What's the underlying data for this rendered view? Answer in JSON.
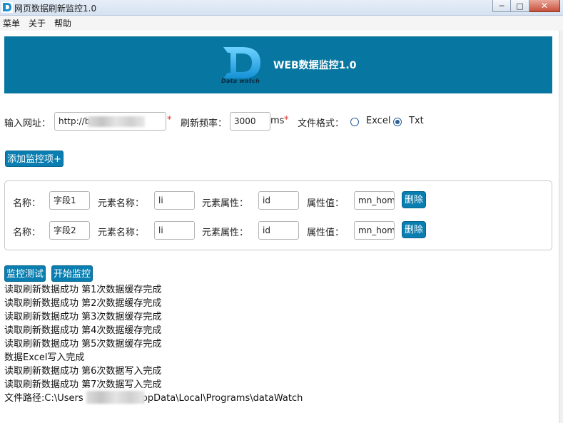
{
  "window": {
    "title": "网页数据刷新监控1.0",
    "min_icon": "minimize-icon",
    "max_icon": "maximize-icon",
    "close_icon": "close-icon",
    "min_glyph": "─",
    "max_glyph": "□",
    "close_glyph": "✕"
  },
  "menu": [
    "菜单",
    "关于",
    "帮助"
  ],
  "banner": {
    "logo_caption": "Data watch",
    "title": "WEB数据监控1.0",
    "bg_color": "#0776a0"
  },
  "form": {
    "url_label": "输入网址：",
    "url_value": "http://b",
    "required_mark": "*",
    "freq_label": "刷新频率：",
    "freq_value": "3000",
    "freq_unit": "ms",
    "format_label": "文件格式：",
    "format_options": [
      "Excel",
      "Txt"
    ],
    "format_selected": "Txt"
  },
  "add_button": "添加监控项+",
  "field_labels": {
    "name": "名称：",
    "element_name": "元素名称：",
    "element_attr": "元素属性：",
    "attr_value": "属性值："
  },
  "fields": [
    {
      "name": "字段1",
      "element_name": "li",
      "element_attr": "id",
      "attr_value": "mn_hom",
      "delete": "删除"
    },
    {
      "name": "字段2",
      "element_name": "li",
      "element_attr": "id",
      "attr_value": "mn_hom",
      "delete": "删除"
    }
  ],
  "actions": {
    "test": "监控测试",
    "start": "开始监控"
  },
  "log": [
    "读取刷新数据成功 第1次数据缓存完成",
    "读取刷新数据成功 第2次数据缓存完成",
    "读取刷新数据成功 第3次数据缓存完成",
    "读取刷新数据成功 第4次数据缓存完成",
    "读取刷新数据成功 第5次数据缓存完成",
    "数据Excel写入完成",
    "读取刷新数据成功 第6次数据写入完成",
    "读取刷新数据成功 第7次数据写入完成"
  ],
  "path": {
    "prefix": "文件路径:C:\\Users",
    "suffix": "ppData\\Local\\Programs\\dataWatch"
  }
}
